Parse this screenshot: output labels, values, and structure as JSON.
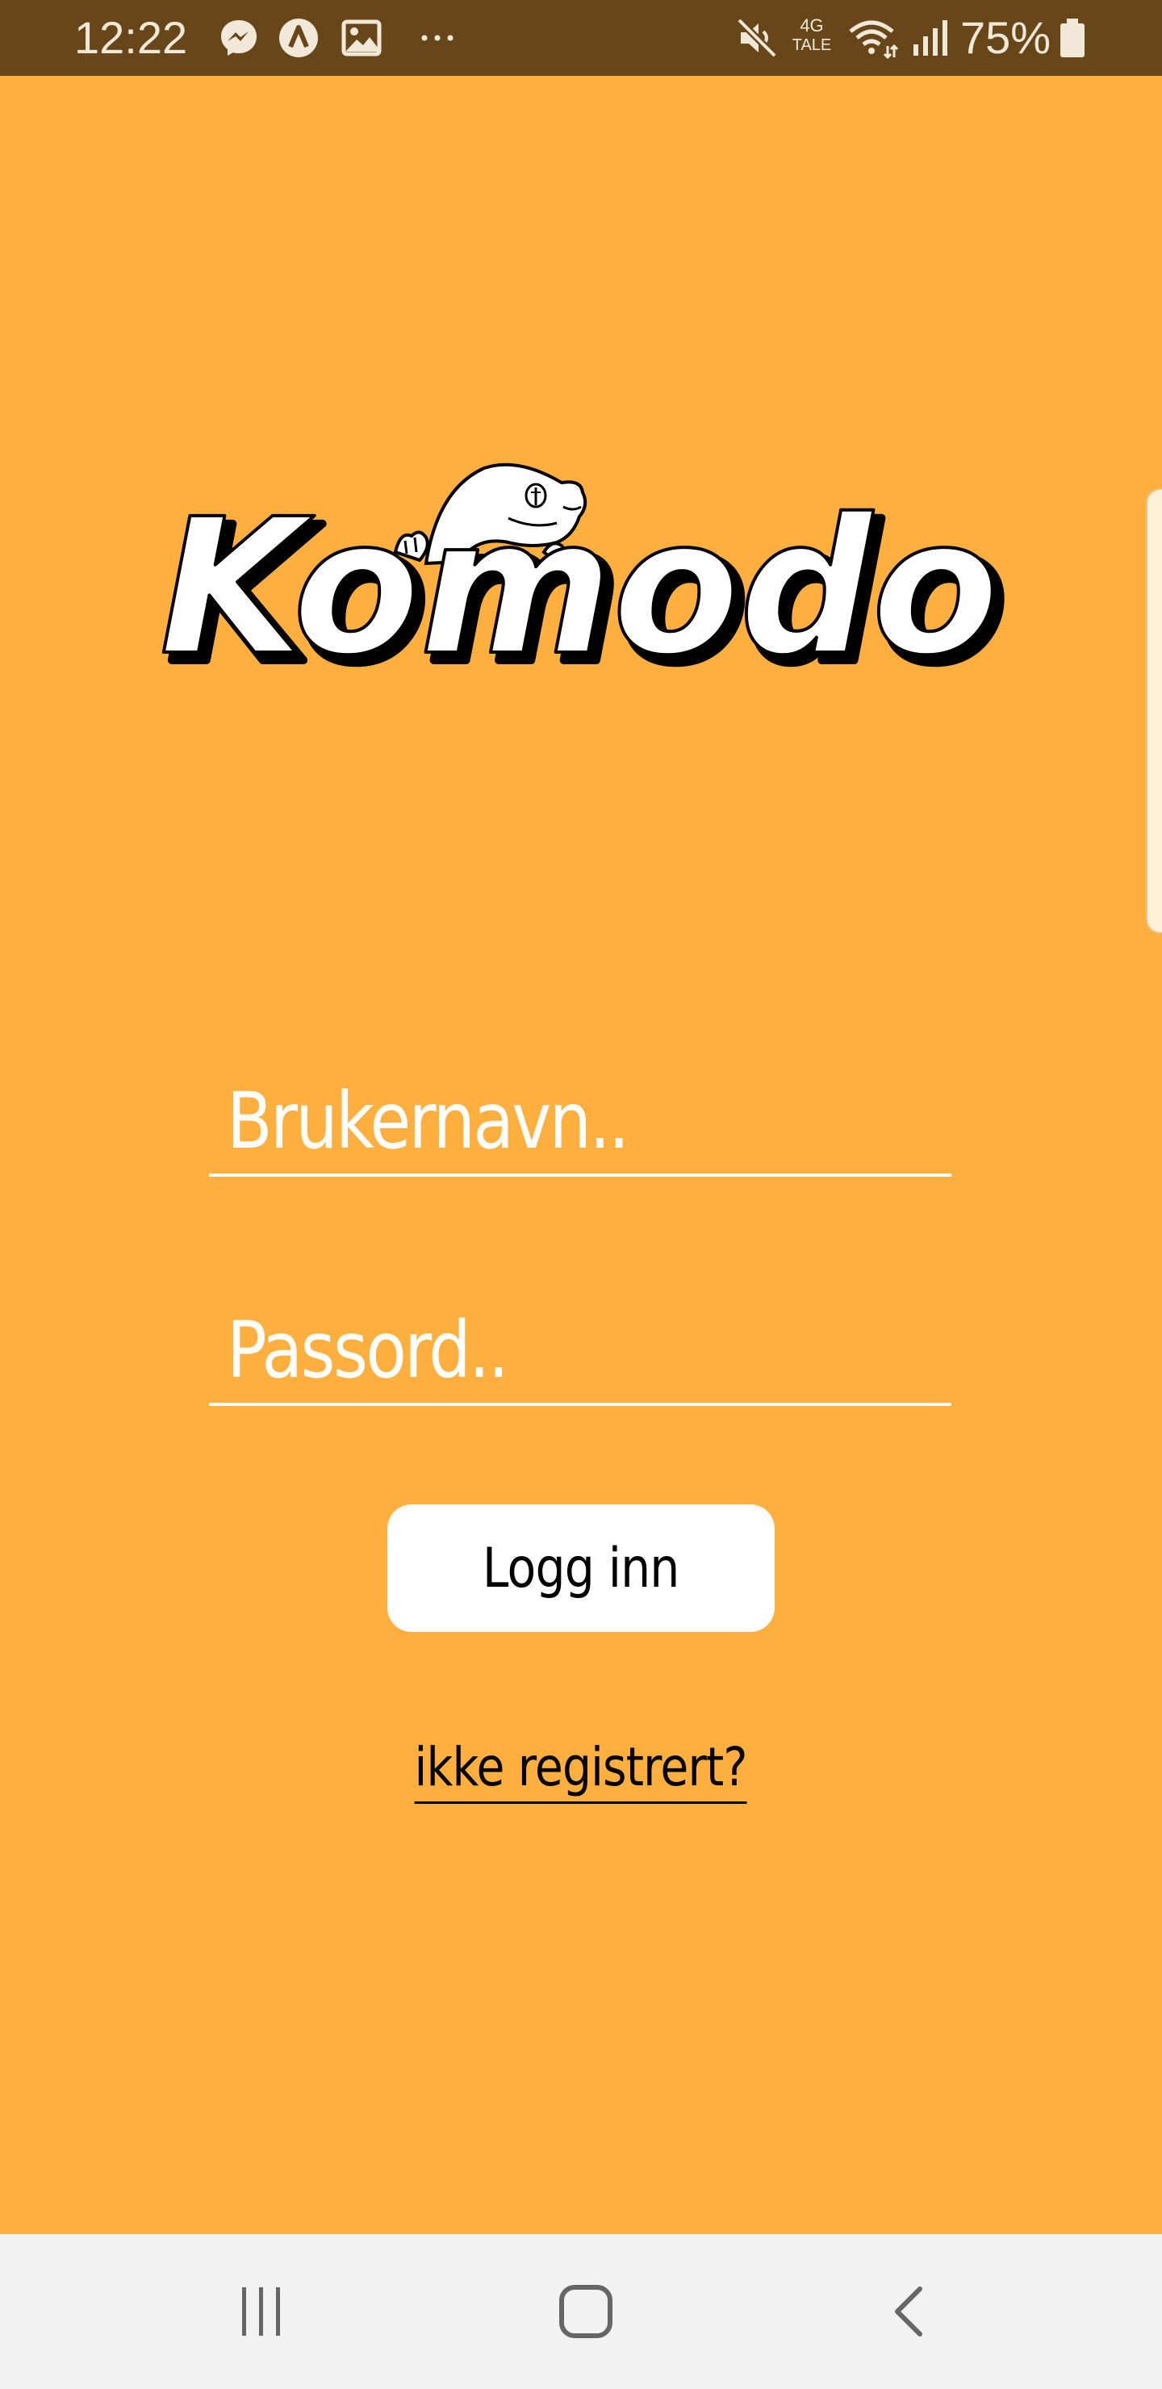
{
  "status_bar": {
    "time": "12:22",
    "notification_icons": [
      "messenger-icon",
      "app-a-icon",
      "image-icon",
      "more-dots-icon"
    ],
    "network_top": "4G",
    "network_bottom": "TALE",
    "battery_percent": "75%",
    "system_icons": [
      "mute-icon",
      "wifi-icon",
      "signal-icon",
      "battery-icon"
    ]
  },
  "logo": {
    "text": "Komodo"
  },
  "login_form": {
    "username_placeholder": "Brukernavn..",
    "password_placeholder": "Passord..",
    "login_button_label": "Logg inn",
    "register_link_label": "ikke registrert?"
  },
  "nav_bar": {
    "buttons": [
      "recents-icon",
      "home-icon",
      "back-icon"
    ]
  },
  "colors": {
    "background": "#FFAF3D",
    "status_bar": "#67461A",
    "nav_bar": "#F2F2F2",
    "button": "#FFFFFF",
    "text_light": "#FFFFFF",
    "text_dark": "#000000"
  }
}
